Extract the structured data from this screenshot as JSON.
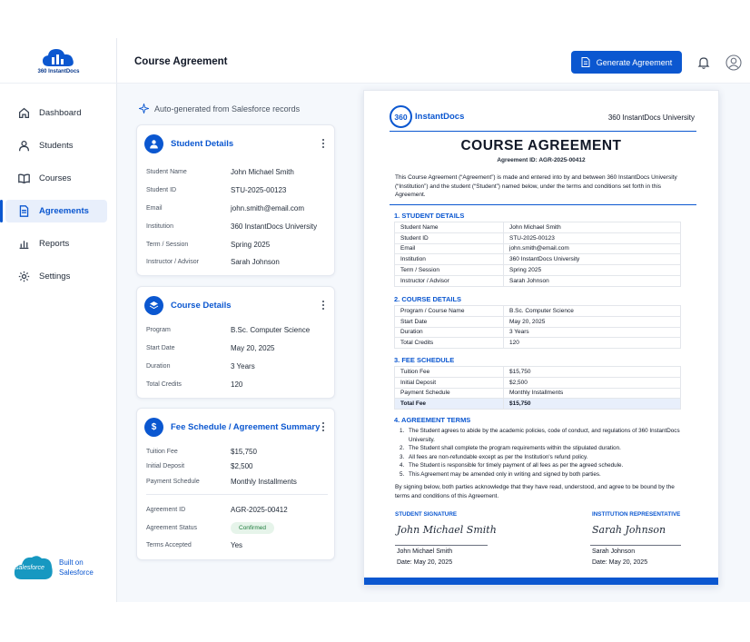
{
  "app": {
    "logo_text": "360 InstantDocs"
  },
  "sidebar": {
    "items": [
      {
        "label": "Dashboard"
      },
      {
        "label": "Students"
      },
      {
        "label": "Courses"
      },
      {
        "label": "Agreements"
      },
      {
        "label": "Reports"
      },
      {
        "label": "Settings"
      }
    ],
    "active": "Agreements",
    "salesforce": {
      "logo_text": "salesforce",
      "line1": "Built on",
      "line2": "Salesforce"
    }
  },
  "header": {
    "title": "Course Agreement",
    "generate_label": "Generate Agreement"
  },
  "left": {
    "auto_note": "Auto-generated from Salesforce records",
    "student": {
      "title": "Student Details",
      "rows": [
        {
          "k": "Student Name",
          "v": "John Michael Smith"
        },
        {
          "k": "Student ID",
          "v": "STU-2025-00123"
        },
        {
          "k": "Email",
          "v": "john.smith@email.com"
        },
        {
          "k": "Institution",
          "v": "360 InstantDocs University"
        },
        {
          "k": "Term / Session",
          "v": "Spring 2025"
        },
        {
          "k": "Instructor / Advisor",
          "v": "Sarah Johnson"
        }
      ]
    },
    "course": {
      "title": "Course Details",
      "rows": [
        {
          "k": "Program",
          "v": "B.Sc. Computer Science"
        },
        {
          "k": "Start Date",
          "v": "May 20, 2025"
        },
        {
          "k": "Duration",
          "v": "3 Years"
        },
        {
          "k": "Total Credits",
          "v": "120"
        }
      ]
    },
    "fee": {
      "title": "Fee Schedule / Agreement Summary",
      "rows": [
        {
          "k": "Tuition Fee",
          "v": "$15,750"
        },
        {
          "k": "Initial Deposit",
          "v": "$2,500"
        },
        {
          "k": "Payment Schedule",
          "v": "Monthly Installments"
        }
      ],
      "summary": [
        {
          "k": "Agreement ID",
          "v": "AGR-2025-00412"
        },
        {
          "k": "Agreement Status",
          "v": "Confirmed"
        },
        {
          "k": "Terms Accepted",
          "v": "Yes"
        }
      ]
    }
  },
  "doc": {
    "logo_ring": "360",
    "logo_name": "InstantDocs",
    "university": "360 InstantDocs University",
    "title": "COURSE AGREEMENT",
    "agreement_id": "Agreement ID: AGR-2025-00412",
    "intro": "This Course Agreement (“Agreement”) is made and entered into by and between 360 InstantDocs University (“Institution”) and the student (“Student”) named below, under the terms and conditions set forth in this Agreement.",
    "sec1": "1. STUDENT DETAILS",
    "student_rows": [
      {
        "k": "Student Name",
        "v": "John Michael Smith"
      },
      {
        "k": "Student ID",
        "v": "STU-2025-00123"
      },
      {
        "k": "Email",
        "v": "john.smith@email.com"
      },
      {
        "k": "Institution",
        "v": "360 InstantDocs University"
      },
      {
        "k": "Term / Session",
        "v": "Spring 2025"
      },
      {
        "k": "Instructor / Advisor",
        "v": "Sarah Johnson"
      }
    ],
    "sec2": "2. COURSE DETAILS",
    "course_rows": [
      {
        "k": "Program / Course Name",
        "v": "B.Sc. Computer Science"
      },
      {
        "k": "Start Date",
        "v": "May 20, 2025"
      },
      {
        "k": "Duration",
        "v": "3 Years"
      },
      {
        "k": "Total Credits",
        "v": "120"
      }
    ],
    "sec3": "3. FEE SCHEDULE",
    "fee_rows": [
      {
        "k": "Tuition Fee",
        "v": "$15,750"
      },
      {
        "k": "Initial Deposit",
        "v": "$2,500"
      },
      {
        "k": "Payment Schedule",
        "v": "Monthly Installments"
      },
      {
        "k": "Total Fee",
        "v": "$15,750"
      }
    ],
    "sec4": "4. AGREEMENT TERMS",
    "terms": [
      {
        "n": "1.",
        "t": "The Student agrees to abide by the academic policies, code of conduct, and regulations of 360 InstantDocs University."
      },
      {
        "n": "2.",
        "t": "The Student shall complete the program requirements within the stipulated duration."
      },
      {
        "n": "3.",
        "t": "All fees are non-refundable except as per the Institution's refund policy."
      },
      {
        "n": "4.",
        "t": "The Student is responsible for timely payment of all fees as per the agreed schedule."
      },
      {
        "n": "5.",
        "t": "This Agreement may be amended only in writing and signed by both parties."
      }
    ],
    "closing": "By signing below, both parties acknowledge that they have read, understood, and agree to be bound by the terms and conditions of this Agreement.",
    "student_sig": {
      "label": "STUDENT SIGNATURE",
      "script": "John Michael Smith",
      "name": "John Michael Smith",
      "date": "Date: May 20, 2025"
    },
    "inst_sig": {
      "label": "INSTITUTION REPRESENTATIVE",
      "script": "Sarah Johnson",
      "name": "Sarah Johnson",
      "date": "Date: May 20, 2025"
    }
  },
  "colors": {
    "accent": "#0b57d0",
    "status_green": "#1e7b3c"
  }
}
